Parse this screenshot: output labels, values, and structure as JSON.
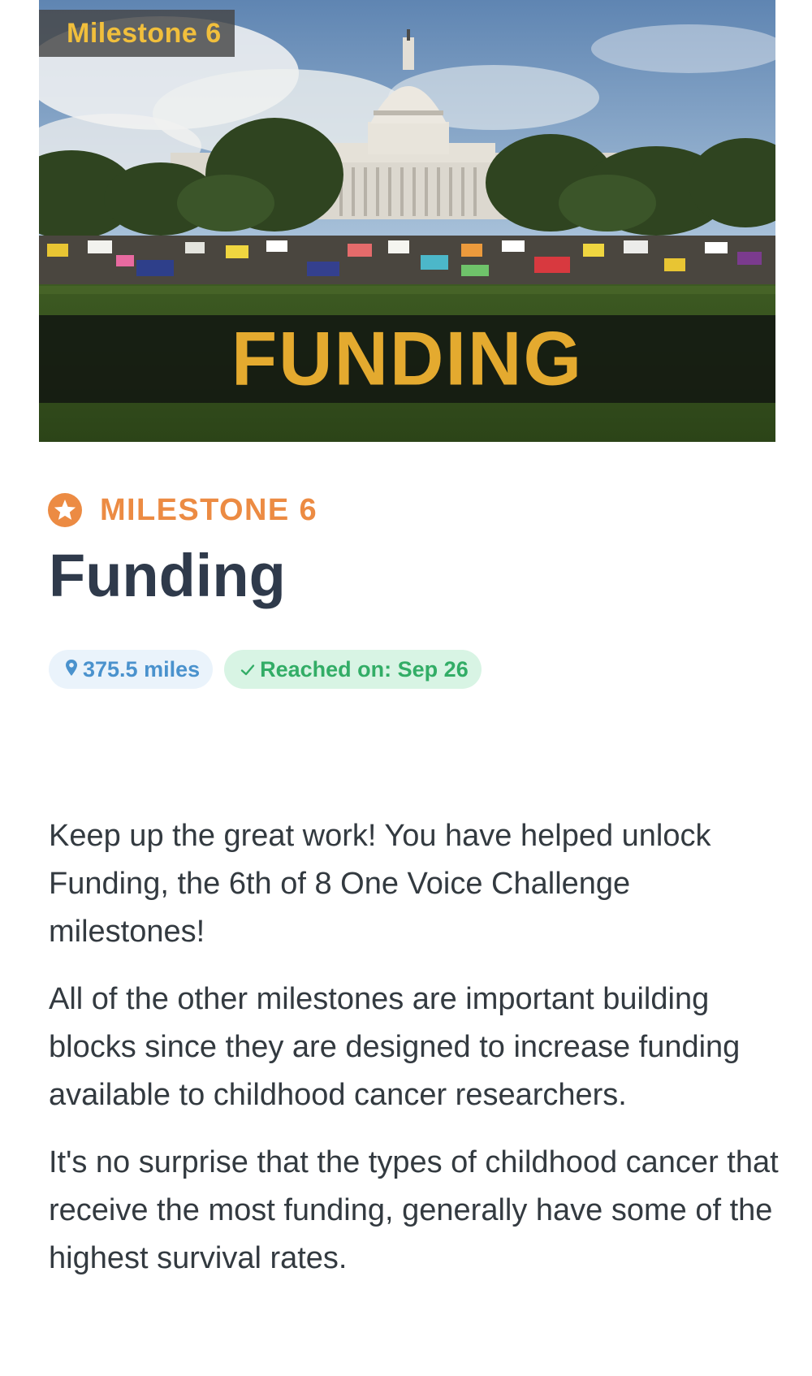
{
  "hero": {
    "tag": "Milestone 6",
    "banner": "FUNDING"
  },
  "milestone": {
    "eyebrow": "MILESTONE 6",
    "title": "Funding",
    "distance": "375.5 miles",
    "reached": "Reached on: Sep 26"
  },
  "body": {
    "paragraphs": [
      "Keep up the great work! You have helped unlock Funding, the 6th of 8 One Voice Challenge milestones!",
      "All of the other milestones are important building blocks since they are designed to increase funding available to childhood cancer researchers.",
      "It's no surprise that the types of childhood cancer that receive the most funding, generally have some of the highest survival rates."
    ]
  },
  "colors": {
    "accent_orange": "#ec8b43",
    "banner_gold": "#e4aa2f",
    "tag_gold": "#f1bf3c",
    "distance_blue": "#4a92cd",
    "reached_green": "#32ad66",
    "title": "#2f3a4b"
  },
  "icons": {
    "eyebrow": "star-circle-icon",
    "distance": "map-pin-icon",
    "reached": "check-icon"
  }
}
